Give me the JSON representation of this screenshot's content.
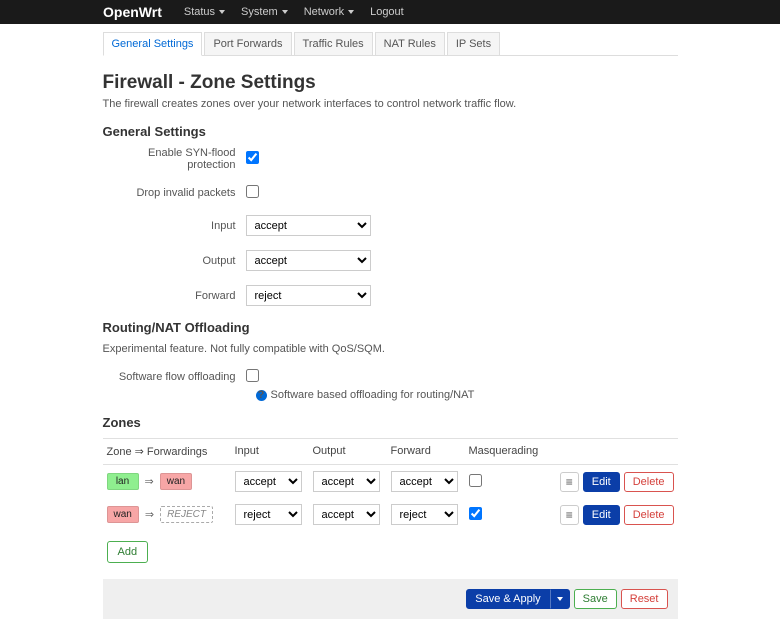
{
  "brand": "OpenWrt",
  "nav": {
    "status": "Status",
    "system": "System",
    "network": "Network",
    "logout": "Logout"
  },
  "tabs": {
    "general": "General Settings",
    "portfwd": "Port Forwards",
    "traffic": "Traffic Rules",
    "nat": "NAT Rules",
    "ipsets": "IP Sets"
  },
  "page": {
    "title": "Firewall - Zone Settings",
    "desc": "The firewall creates zones over your network interfaces to control network traffic flow."
  },
  "general": {
    "header": "General Settings",
    "synflood_label": "Enable SYN-flood protection",
    "synflood": true,
    "dropinvalid_label": "Drop invalid packets",
    "dropinvalid": false,
    "input_label": "Input",
    "input": "accept",
    "output_label": "Output",
    "output": "accept",
    "forward_label": "Forward",
    "forward": "reject"
  },
  "offload": {
    "header": "Routing/NAT Offloading",
    "desc": "Experimental feature. Not fully compatible with QoS/SQM.",
    "sw_label": "Software flow offloading",
    "sw": false,
    "sw_hint": "Software based offloading for routing/NAT"
  },
  "zones": {
    "header": "Zones",
    "col_zone": "Zone ⇒ Forwardings",
    "col_input": "Input",
    "col_output": "Output",
    "col_forward": "Forward",
    "col_masq": "Masquerading",
    "rows": [
      {
        "from": "lan",
        "from_cls": "lan",
        "to": "wan",
        "to_cls": "wan",
        "input": "accept",
        "output": "accept",
        "forward": "accept",
        "masq": false
      },
      {
        "from": "wan",
        "from_cls": "wan",
        "to": "REJECT",
        "to_cls": "reject",
        "input": "reject",
        "output": "accept",
        "forward": "reject",
        "masq": true
      }
    ]
  },
  "buttons": {
    "edit": "Edit",
    "delete": "Delete",
    "add": "Add",
    "save_apply": "Save & Apply",
    "save": "Save",
    "reset": "Reset"
  }
}
